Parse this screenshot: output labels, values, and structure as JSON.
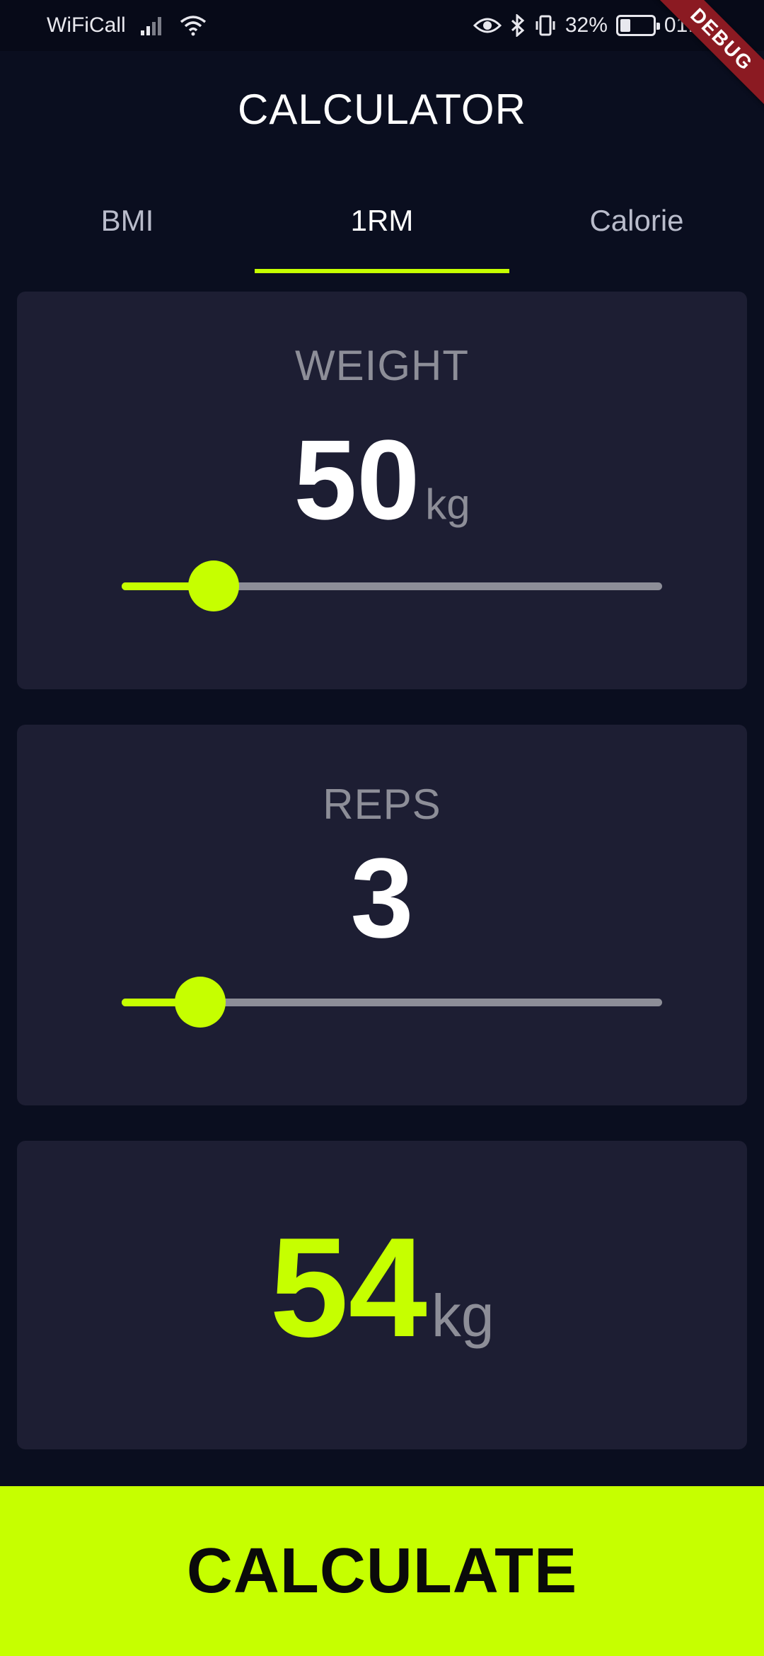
{
  "status_bar": {
    "carrier": "WiFiCall",
    "battery_percent": "32%",
    "battery_level": 0.32,
    "time": "01:36",
    "icons": [
      "signal-bars-icon",
      "wifi-icon",
      "eye-icon",
      "bluetooth-icon",
      "vibrate-icon",
      "battery-icon"
    ]
  },
  "debug_banner": "DEBUG",
  "header": {
    "title": "CALCULATOR"
  },
  "tabs": [
    {
      "label": "BMI",
      "active": false
    },
    {
      "label": "1RM",
      "active": true
    },
    {
      "label": "Calorie",
      "active": false
    }
  ],
  "weight": {
    "label": "WEIGHT",
    "value": "50",
    "unit": "kg",
    "slider_fraction": 0.17
  },
  "reps": {
    "label": "REPS",
    "value": "3",
    "slider_fraction": 0.145
  },
  "result": {
    "value": "54",
    "unit": "kg"
  },
  "calculate_button": {
    "label": "CALCULATE"
  },
  "colors": {
    "background": "#0a0e1f",
    "card": "#1d1e33",
    "accent": "#c6ff00",
    "muted_text": "#8d8e98",
    "debug": "#8b1a22"
  }
}
